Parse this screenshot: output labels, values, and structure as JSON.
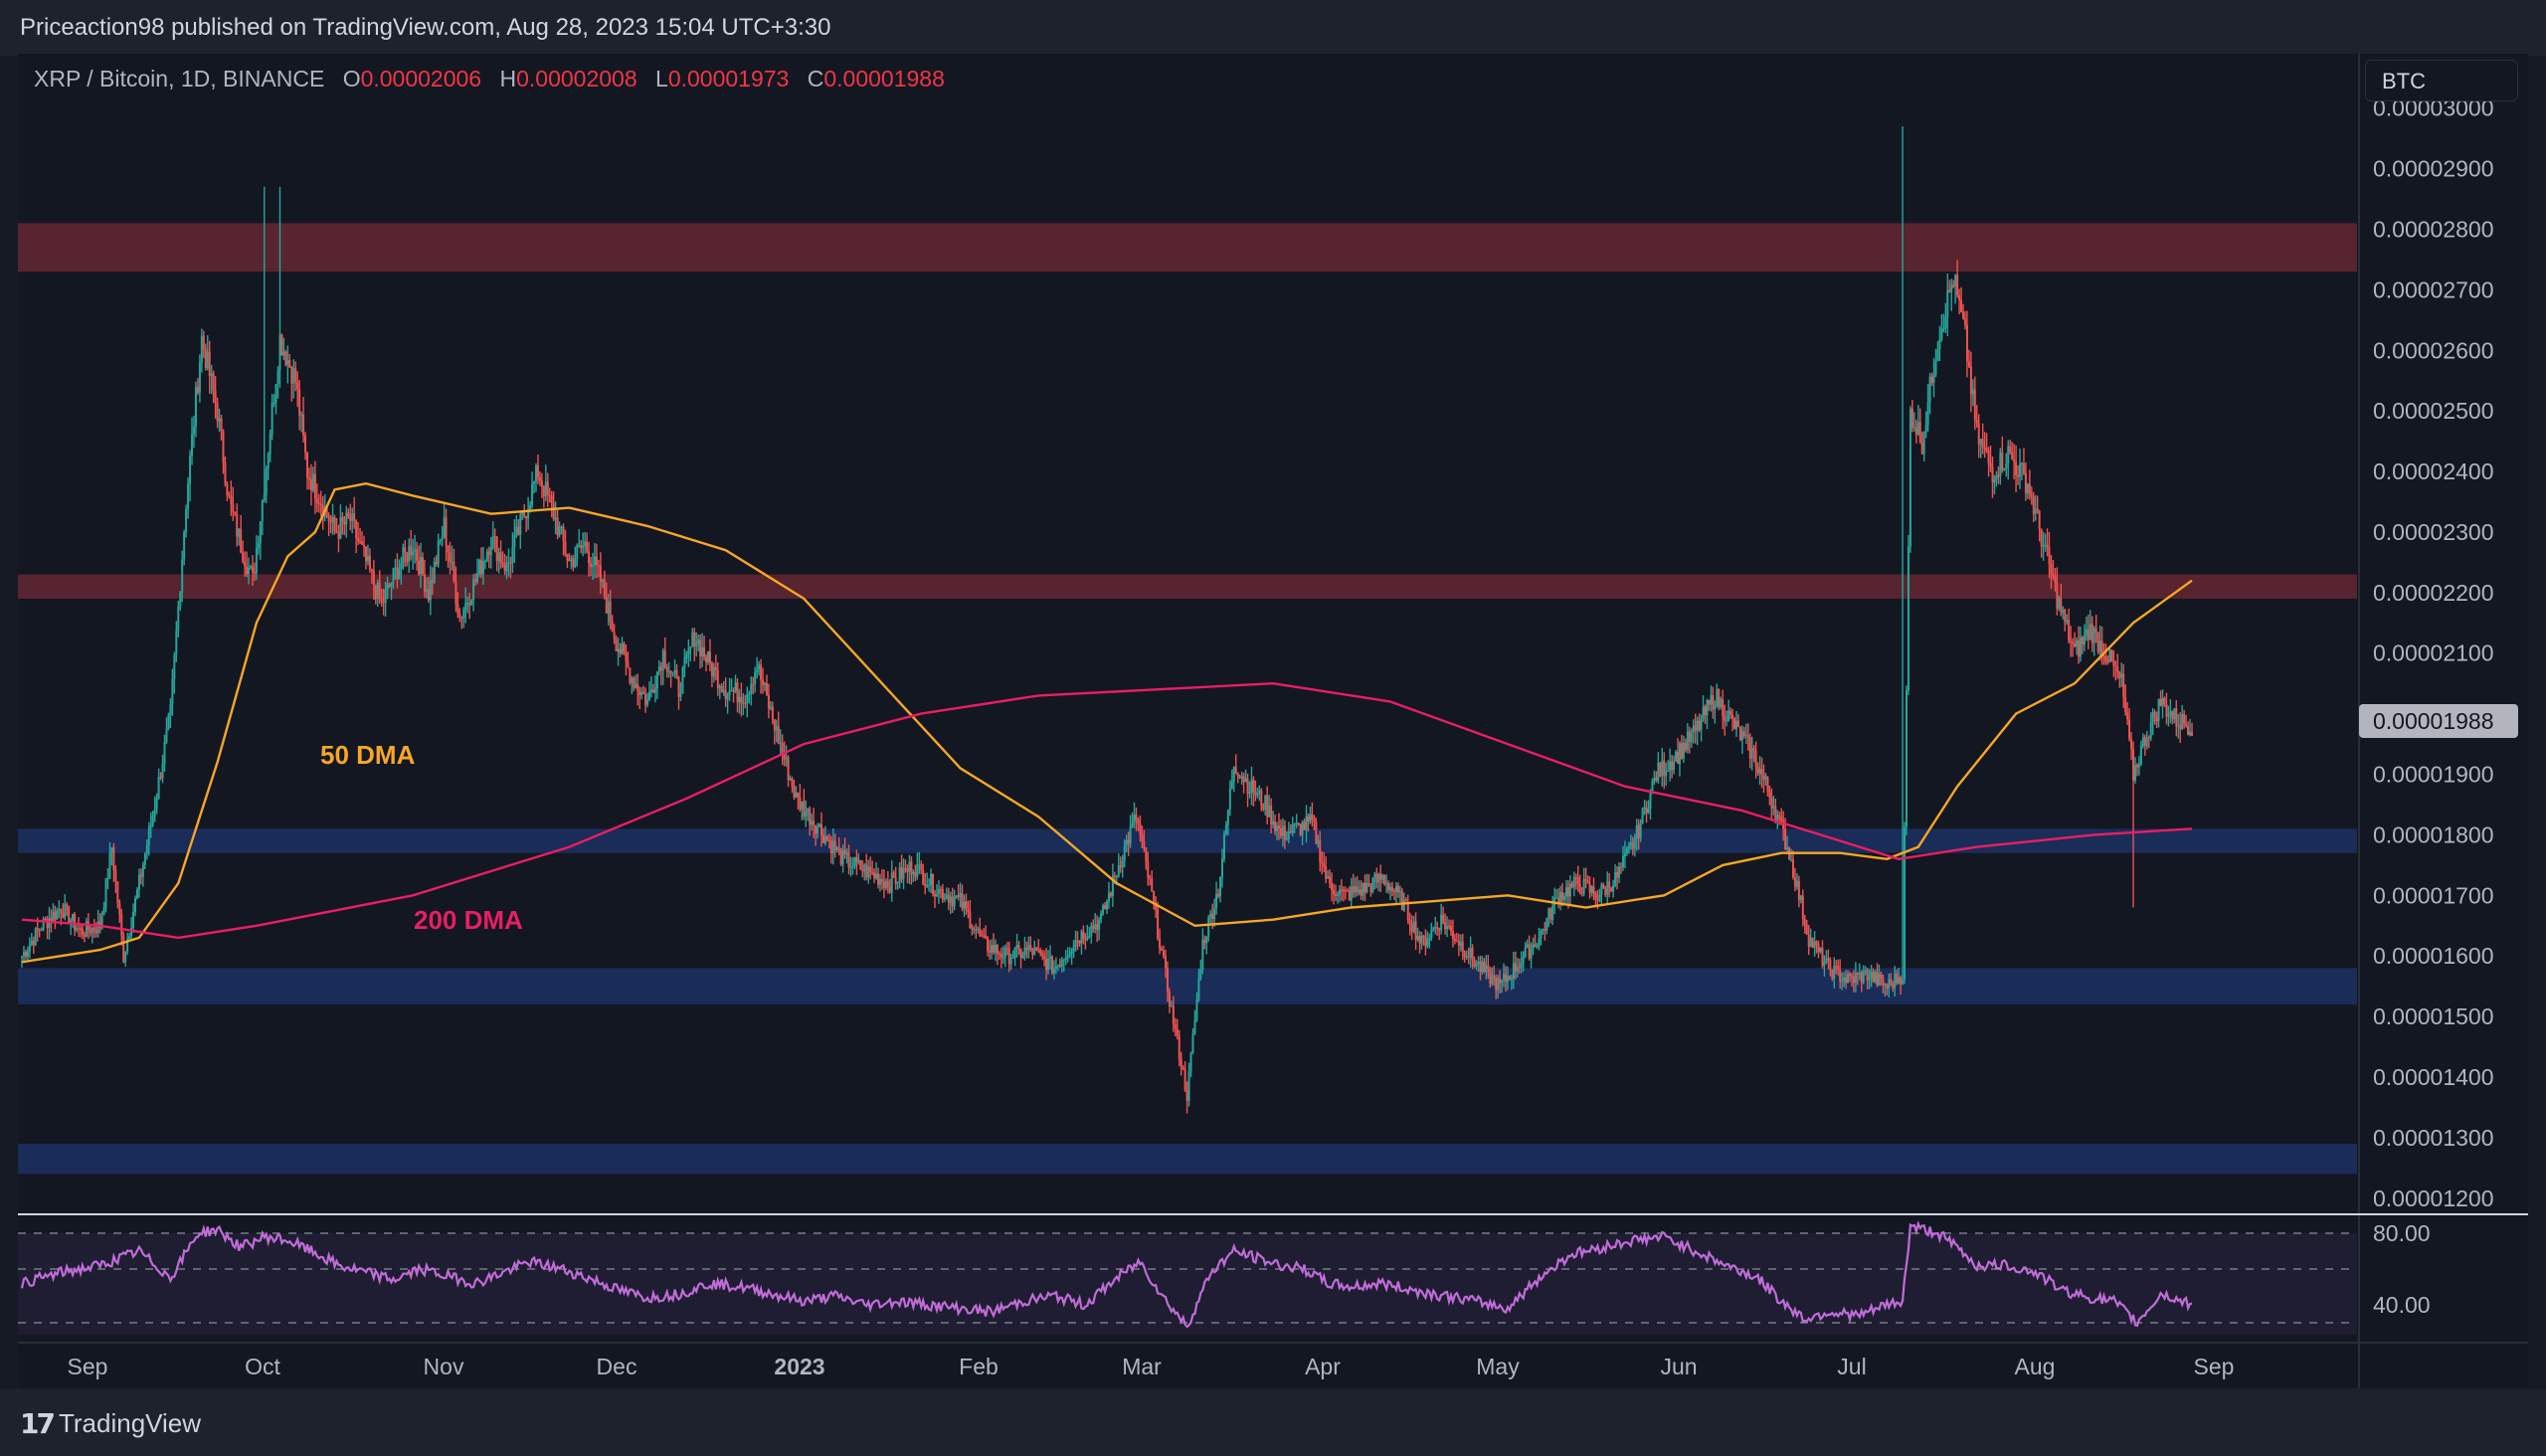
{
  "header": {
    "publisher": "Priceaction98 published on TradingView.com, Aug 28, 2023 15:04 UTC+3:30"
  },
  "legend": {
    "symbol": "XRP / Bitcoin, 1D, BINANCE",
    "open_label": "O",
    "open": "0.00002006",
    "high_label": "H",
    "high": "0.00002008",
    "low_label": "L",
    "low": "0.00001973",
    "close_label": "C",
    "close": "0.00001988"
  },
  "currency_button": "BTC",
  "footer": {
    "brand": "TradingView"
  },
  "colors": {
    "up": "#26a69a",
    "down": "#ef5350",
    "dma50": "#f7a626",
    "dma200": "#e91e63",
    "rsi": "#c06cd8",
    "resistance": "#5c2530",
    "support": "#1c2f5e"
  },
  "chart_data": {
    "type": "candlestick",
    "symbol": "XRP / Bitcoin",
    "timeframe": "1D",
    "price_axis": {
      "ticks": [
        "0.00003000",
        "0.00002900",
        "0.00002800",
        "0.00002700",
        "0.00002600",
        "0.00002500",
        "0.00002400",
        "0.00002300",
        "0.00002200",
        "0.00002100",
        "0.00002000",
        "0.00001900",
        "0.00001800",
        "0.00001700",
        "0.00001600",
        "0.00001500",
        "0.00001400",
        "0.00001300",
        "0.00001200"
      ],
      "current_value": "0.00001988",
      "range": [
        1.175e-05,
        3.08e-05
      ]
    },
    "time_axis": {
      "labels": [
        "Sep",
        "Oct",
        "Nov",
        "Dec",
        "2023",
        "Feb",
        "Mar",
        "Apr",
        "May",
        "Jun",
        "Jul",
        "Aug",
        "Sep"
      ],
      "bold": [
        "2023"
      ]
    },
    "zones": [
      {
        "kind": "resistance",
        "low": 2.73e-05,
        "high": 2.81e-05
      },
      {
        "kind": "resistance",
        "low": 2.19e-05,
        "high": 2.23e-05
      },
      {
        "kind": "support",
        "low": 1.77e-05,
        "high": 1.81e-05
      },
      {
        "kind": "support",
        "low": 1.52e-05,
        "high": 1.58e-05
      },
      {
        "kind": "support",
        "low": 1.24e-05,
        "high": 1.29e-05
      }
    ],
    "annotations": [
      {
        "text": "50 DMA",
        "series": "dma50"
      },
      {
        "text": "200 DMA",
        "series": "dma200"
      }
    ],
    "price_anchors": [
      [
        0,
        1.6e-05
      ],
      [
        10,
        1.65e-05
      ],
      [
        20,
        1.68e-05
      ],
      [
        30,
        1.64e-05
      ],
      [
        40,
        1.65e-05
      ],
      [
        46,
        1.78e-05
      ],
      [
        52,
        1.6e-05
      ],
      [
        60,
        1.72e-05
      ],
      [
        68,
        1.85e-05
      ],
      [
        76,
        2e-05
      ],
      [
        84,
        2.35e-05
      ],
      [
        92,
        2.62e-05
      ],
      [
        100,
        2.5e-05
      ],
      [
        106,
        2.35e-05
      ],
      [
        112,
        2.28e-05
      ],
      [
        118,
        2.22e-05
      ],
      [
        124,
        2.38e-05
      ],
      [
        132,
        2.62e-05
      ],
      [
        140,
        2.55e-05
      ],
      [
        146,
        2.4e-05
      ],
      [
        152,
        2.36e-05
      ],
      [
        160,
        2.3e-05
      ],
      [
        168,
        2.32e-05
      ],
      [
        176,
        2.25e-05
      ],
      [
        184,
        2.18e-05
      ],
      [
        192,
        2.24e-05
      ],
      [
        200,
        2.28e-05
      ],
      [
        208,
        2.2e-05
      ],
      [
        216,
        2.31e-05
      ],
      [
        224,
        2.16e-05
      ],
      [
        232,
        2.22e-05
      ],
      [
        240,
        2.29e-05
      ],
      [
        248,
        2.24e-05
      ],
      [
        256,
        2.32e-05
      ],
      [
        264,
        2.4e-05
      ],
      [
        272,
        2.33e-05
      ],
      [
        280,
        2.25e-05
      ],
      [
        288,
        2.28e-05
      ],
      [
        296,
        2.22e-05
      ],
      [
        304,
        2.12e-05
      ],
      [
        312,
        2.06e-05
      ],
      [
        320,
        2.02e-05
      ],
      [
        328,
        2.1e-05
      ],
      [
        336,
        2.04e-05
      ],
      [
        344,
        2.13e-05
      ],
      [
        352,
        2.08e-05
      ],
      [
        360,
        2.04e-05
      ],
      [
        370,
        2.03e-05
      ],
      [
        376,
        2.08e-05
      ],
      [
        386,
        1.97e-05
      ],
      [
        396,
        1.86e-05
      ],
      [
        408,
        1.81e-05
      ],
      [
        420,
        1.76e-05
      ],
      [
        432,
        1.74e-05
      ],
      [
        444,
        1.72e-05
      ],
      [
        456,
        1.75e-05
      ],
      [
        468,
        1.71e-05
      ],
      [
        480,
        1.69e-05
      ],
      [
        492,
        1.62e-05
      ],
      [
        504,
        1.6e-05
      ],
      [
        516,
        1.61e-05
      ],
      [
        528,
        1.58e-05
      ],
      [
        540,
        1.63e-05
      ],
      [
        552,
        1.66e-05
      ],
      [
        562,
        1.76e-05
      ],
      [
        570,
        1.83e-05
      ],
      [
        578,
        1.7e-05
      ],
      [
        588,
        1.51e-05
      ],
      [
        596,
        1.37e-05
      ],
      [
        604,
        1.62e-05
      ],
      [
        612,
        1.71e-05
      ],
      [
        620,
        1.92e-05
      ],
      [
        628,
        1.88e-05
      ],
      [
        636,
        1.85e-05
      ],
      [
        644,
        1.8e-05
      ],
      [
        652,
        1.81e-05
      ],
      [
        660,
        1.82e-05
      ],
      [
        668,
        1.72e-05
      ],
      [
        676,
        1.7e-05
      ],
      [
        686,
        1.71e-05
      ],
      [
        696,
        1.73e-05
      ],
      [
        706,
        1.69e-05
      ],
      [
        716,
        1.62e-05
      ],
      [
        726,
        1.66e-05
      ],
      [
        736,
        1.62e-05
      ],
      [
        746,
        1.58e-05
      ],
      [
        756,
        1.55e-05
      ],
      [
        766,
        1.59e-05
      ],
      [
        776,
        1.63e-05
      ],
      [
        786,
        1.7e-05
      ],
      [
        796,
        1.72e-05
      ],
      [
        806,
        1.7e-05
      ],
      [
        816,
        1.73e-05
      ],
      [
        826,
        1.8e-05
      ],
      [
        836,
        1.9e-05
      ],
      [
        846,
        1.93e-05
      ],
      [
        856,
        1.97e-05
      ],
      [
        866,
        2.03e-05
      ],
      [
        876,
        1.98e-05
      ],
      [
        886,
        1.93e-05
      ],
      [
        896,
        1.85e-05
      ],
      [
        904,
        1.77e-05
      ],
      [
        914,
        1.63e-05
      ],
      [
        924,
        1.58e-05
      ],
      [
        934,
        1.56e-05
      ],
      [
        944,
        1.57e-05
      ],
      [
        954,
        1.55e-05
      ],
      [
        962,
        1.57e-05
      ],
      [
        966,
        2.5e-05
      ],
      [
        972,
        2.45e-05
      ],
      [
        980,
        2.62e-05
      ],
      [
        988,
        2.72e-05
      ],
      [
        994,
        2.62e-05
      ],
      [
        1000,
        2.46e-05
      ],
      [
        1008,
        2.4e-05
      ],
      [
        1016,
        2.43e-05
      ],
      [
        1026,
        2.38e-05
      ],
      [
        1034,
        2.28e-05
      ],
      [
        1042,
        2.18e-05
      ],
      [
        1050,
        2.1e-05
      ],
      [
        1058,
        2.14e-05
      ],
      [
        1066,
        2.1e-05
      ],
      [
        1074,
        2.05e-05
      ],
      [
        1080,
        1.9e-05
      ],
      [
        1086,
        1.96e-05
      ],
      [
        1094,
        2.02e-05
      ],
      [
        1102,
        1.99e-05
      ],
      [
        1110,
        1.98e-05
      ]
    ],
    "candle_count": 1111,
    "candle_spacing_days": 1,
    "dma50_points": [
      [
        0,
        1.59e-05
      ],
      [
        40,
        1.61e-05
      ],
      [
        60,
        1.63e-05
      ],
      [
        80,
        1.72e-05
      ],
      [
        100,
        1.92e-05
      ],
      [
        120,
        2.15e-05
      ],
      [
        136,
        2.26e-05
      ],
      [
        150,
        2.3e-05
      ],
      [
        160,
        2.37e-05
      ],
      [
        176,
        2.38e-05
      ],
      [
        200,
        2.36e-05
      ],
      [
        240,
        2.33e-05
      ],
      [
        280,
        2.34e-05
      ],
      [
        320,
        2.31e-05
      ],
      [
        360,
        2.27e-05
      ],
      [
        400,
        2.19e-05
      ],
      [
        440,
        2.05e-05
      ],
      [
        480,
        1.91e-05
      ],
      [
        520,
        1.83e-05
      ],
      [
        560,
        1.72e-05
      ],
      [
        600,
        1.65e-05
      ],
      [
        640,
        1.66e-05
      ],
      [
        680,
        1.68e-05
      ],
      [
        720,
        1.69e-05
      ],
      [
        760,
        1.7e-05
      ],
      [
        800,
        1.68e-05
      ],
      [
        840,
        1.7e-05
      ],
      [
        870,
        1.75e-05
      ],
      [
        900,
        1.77e-05
      ],
      [
        930,
        1.77e-05
      ],
      [
        954,
        1.76e-05
      ],
      [
        970,
        1.78e-05
      ],
      [
        990,
        1.88e-05
      ],
      [
        1020,
        2e-05
      ],
      [
        1050,
        2.05e-05
      ],
      [
        1080,
        2.15e-05
      ],
      [
        1110,
        2.22e-05
      ]
    ],
    "dma200_points": [
      [
        0,
        1.66e-05
      ],
      [
        40,
        1.65e-05
      ],
      [
        80,
        1.63e-05
      ],
      [
        120,
        1.65e-05
      ],
      [
        200,
        1.7e-05
      ],
      [
        280,
        1.78e-05
      ],
      [
        340,
        1.86e-05
      ],
      [
        400,
        1.95e-05
      ],
      [
        460,
        2e-05
      ],
      [
        520,
        2.03e-05
      ],
      [
        580,
        2.04e-05
      ],
      [
        640,
        2.05e-05
      ],
      [
        700,
        2.02e-05
      ],
      [
        760,
        1.95e-05
      ],
      [
        820,
        1.88e-05
      ],
      [
        880,
        1.84e-05
      ],
      [
        920,
        1.8e-05
      ],
      [
        960,
        1.76e-05
      ],
      [
        1000,
        1.78e-05
      ],
      [
        1060,
        1.8e-05
      ],
      [
        1110,
        1.81e-05
      ]
    ],
    "rsi": {
      "levels": [
        80,
        40
      ],
      "tick_labels": [
        "80.00",
        "40.00"
      ],
      "range": [
        20,
        90
      ],
      "points": [
        [
          0,
          52
        ],
        [
          20,
          58
        ],
        [
          40,
          62
        ],
        [
          60,
          70
        ],
        [
          76,
          55
        ],
        [
          90,
          80
        ],
        [
          100,
          82
        ],
        [
          112,
          72
        ],
        [
          124,
          78
        ],
        [
          136,
          76
        ],
        [
          148,
          70
        ],
        [
          162,
          62
        ],
        [
          176,
          58
        ],
        [
          190,
          54
        ],
        [
          204,
          60
        ],
        [
          218,
          56
        ],
        [
          232,
          52
        ],
        [
          246,
          58
        ],
        [
          260,
          64
        ],
        [
          276,
          60
        ],
        [
          292,
          54
        ],
        [
          306,
          48
        ],
        [
          320,
          44
        ],
        [
          336,
          46
        ],
        [
          352,
          52
        ],
        [
          368,
          50
        ],
        [
          384,
          46
        ],
        [
          400,
          42
        ],
        [
          416,
          45
        ],
        [
          432,
          40
        ],
        [
          448,
          42
        ],
        [
          464,
          40
        ],
        [
          480,
          38
        ],
        [
          496,
          36
        ],
        [
          512,
          42
        ],
        [
          528,
          45
        ],
        [
          544,
          40
        ],
        [
          560,
          55
        ],
        [
          572,
          64
        ],
        [
          584,
          44
        ],
        [
          596,
          28
        ],
        [
          608,
          58
        ],
        [
          620,
          70
        ],
        [
          632,
          66
        ],
        [
          644,
          62
        ],
        [
          656,
          60
        ],
        [
          668,
          52
        ],
        [
          680,
          50
        ],
        [
          696,
          52
        ],
        [
          712,
          48
        ],
        [
          728,
          45
        ],
        [
          744,
          42
        ],
        [
          760,
          38
        ],
        [
          776,
          55
        ],
        [
          792,
          68
        ],
        [
          808,
          72
        ],
        [
          824,
          76
        ],
        [
          840,
          78
        ],
        [
          856,
          70
        ],
        [
          872,
          62
        ],
        [
          888,
          55
        ],
        [
          900,
          42
        ],
        [
          912,
          32
        ],
        [
          924,
          36
        ],
        [
          940,
          34
        ],
        [
          954,
          40
        ],
        [
          962,
          42
        ],
        [
          966,
          84
        ],
        [
          980,
          80
        ],
        [
          990,
          72
        ],
        [
          1000,
          62
        ],
        [
          1016,
          62
        ],
        [
          1030,
          58
        ],
        [
          1044,
          48
        ],
        [
          1058,
          44
        ],
        [
          1070,
          42
        ],
        [
          1082,
          30
        ],
        [
          1094,
          46
        ],
        [
          1110,
          40
        ]
      ]
    }
  }
}
